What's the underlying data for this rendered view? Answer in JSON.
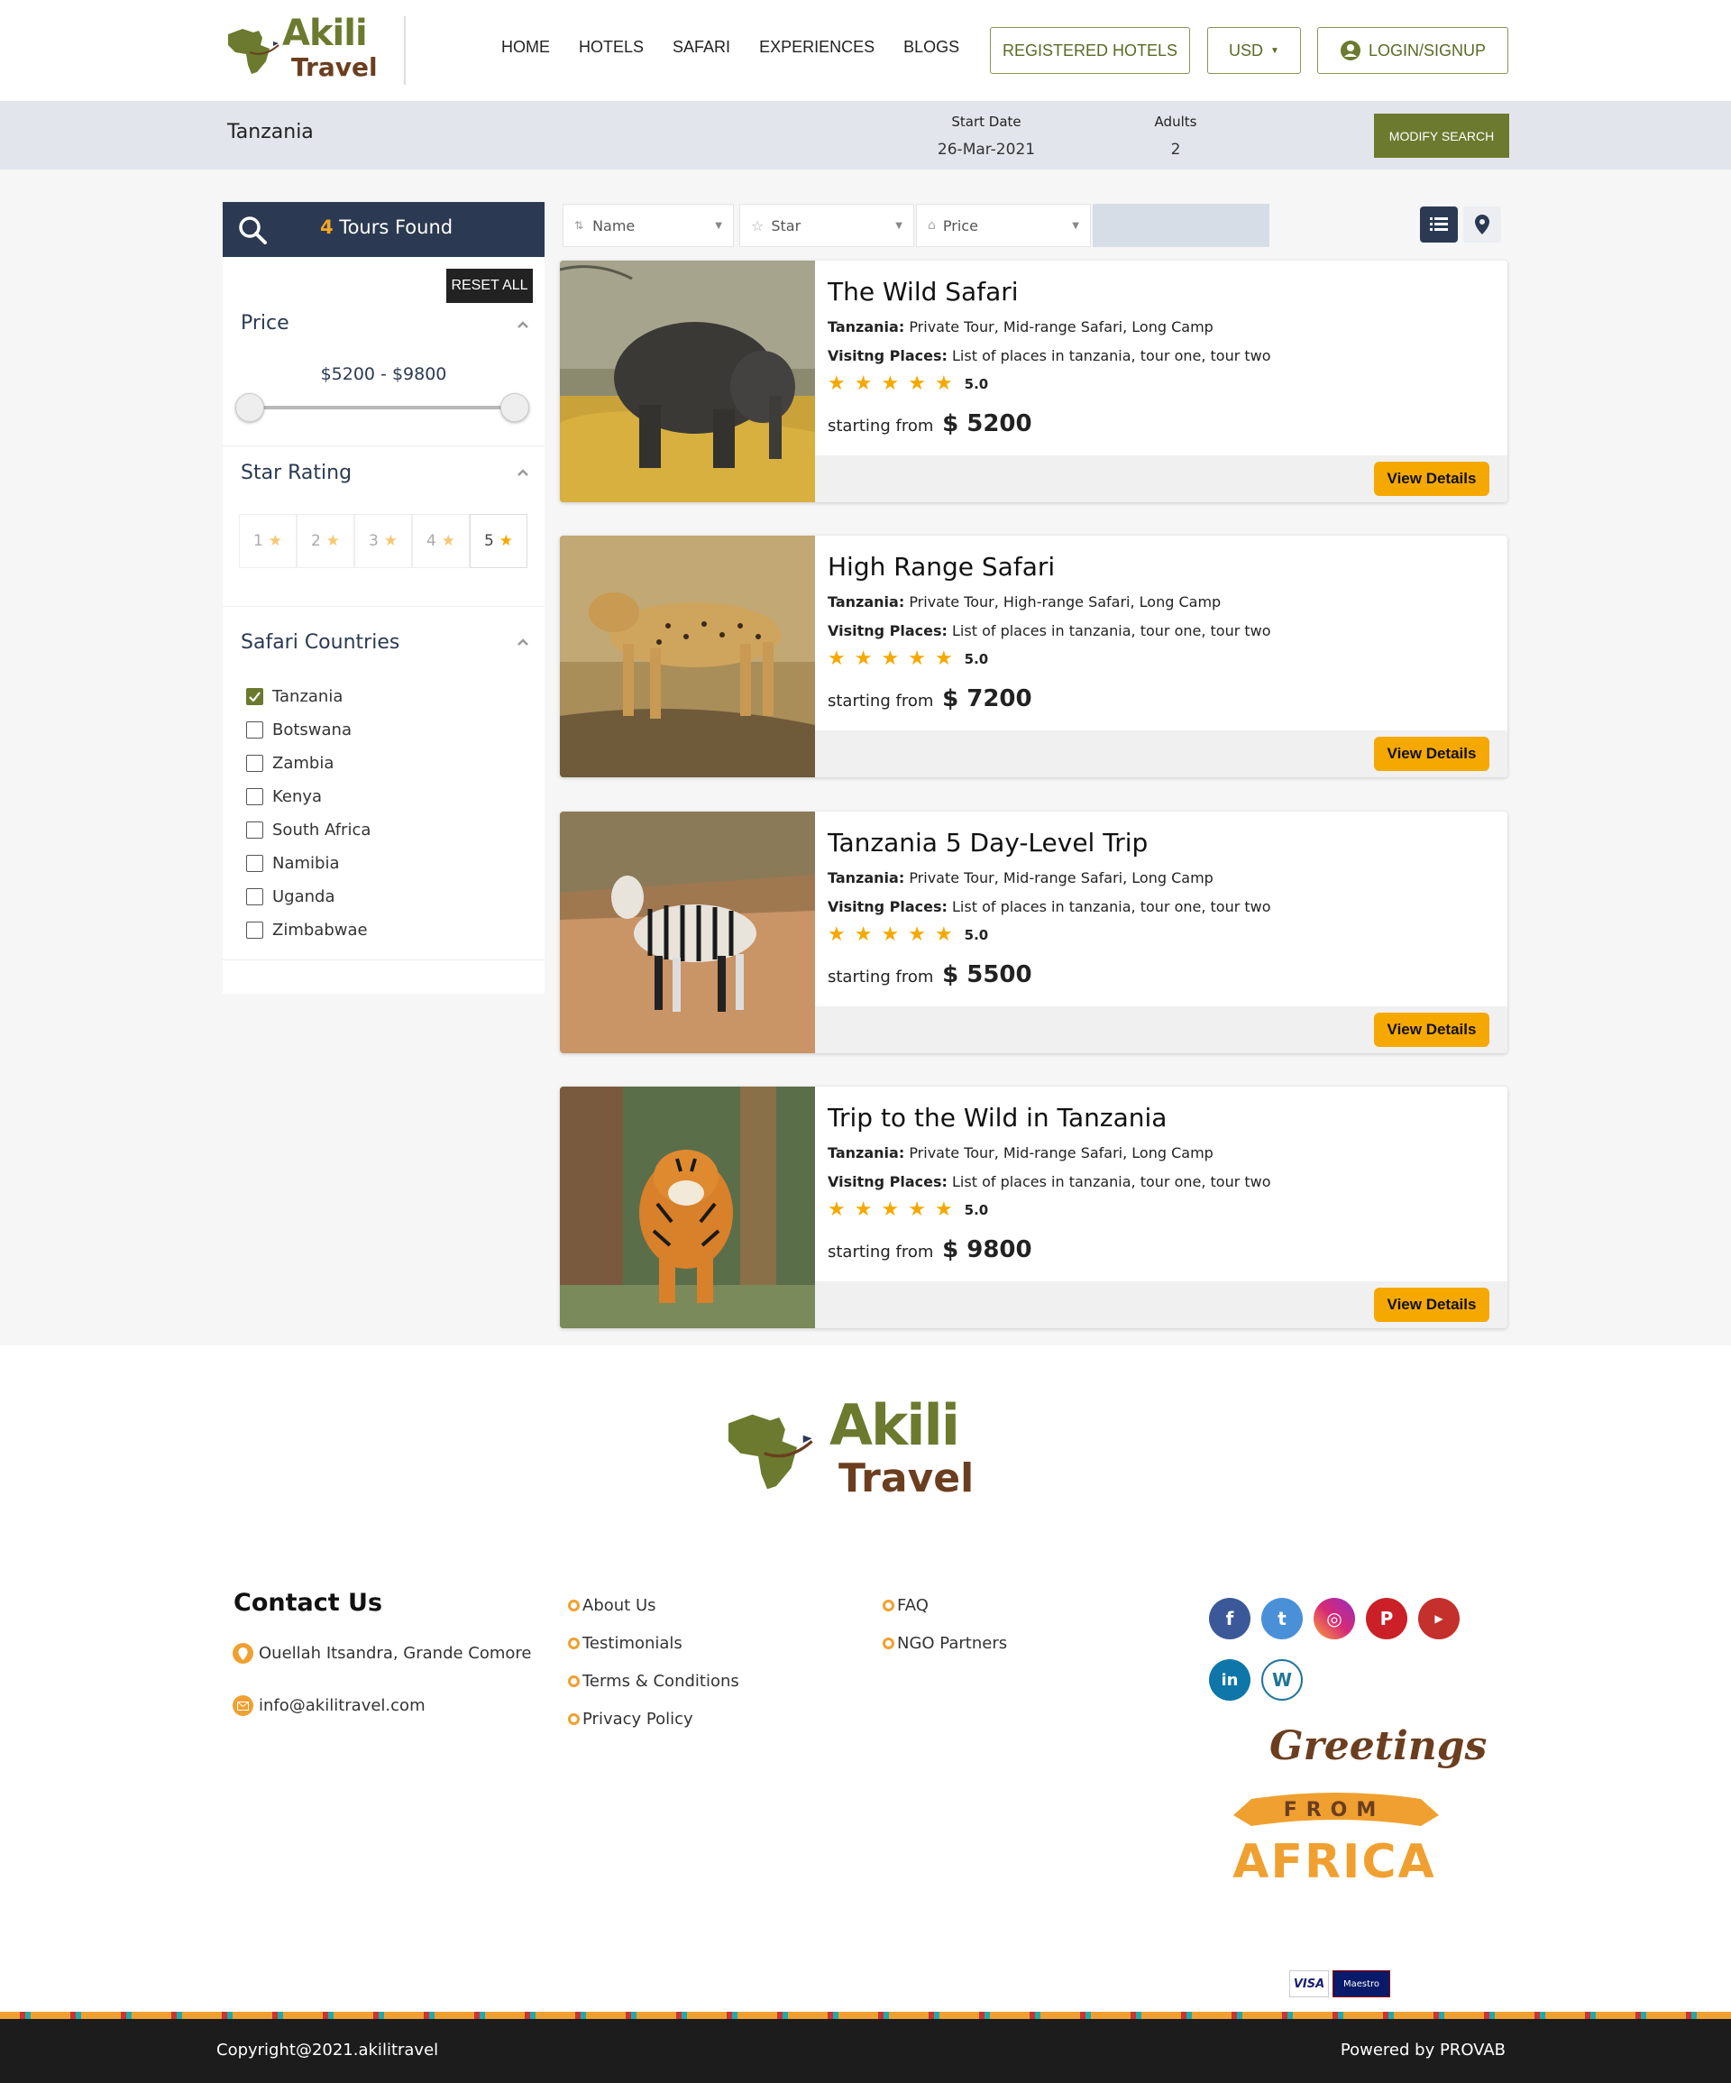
{
  "brand": {
    "name": "Akili",
    "sub": "Travel"
  },
  "nav": [
    "HOME",
    "HOTELS",
    "SAFARI",
    "EXPERIENCES",
    "BLOGS"
  ],
  "header_buttons": {
    "registered": "REGISTERED HOTELS",
    "currency": "USD",
    "login": "LOGIN/SIGNUP"
  },
  "search": {
    "destination": "Tanzania",
    "start_label": "Start Date",
    "start_value": "26-Mar-2021",
    "adults_label": "Adults",
    "adults_value": "2",
    "modify": "MODIFY SEARCH"
  },
  "sidebar": {
    "count": "4",
    "found_text": "Tours Found",
    "reset": "RESET ALL",
    "price_title": "Price",
    "price_range": "$5200 - $9800",
    "star_title": "Star Rating",
    "stars": [
      "1",
      "2",
      "3",
      "4",
      "5"
    ],
    "selected_star": "5",
    "countries_title": "Safari Countries",
    "countries": [
      {
        "name": "Tanzania",
        "checked": true
      },
      {
        "name": "Botswana",
        "checked": false
      },
      {
        "name": "Zambia",
        "checked": false
      },
      {
        "name": "Kenya",
        "checked": false
      },
      {
        "name": "South Africa",
        "checked": false
      },
      {
        "name": "Namibia",
        "checked": false
      },
      {
        "name": "Uganda",
        "checked": false
      },
      {
        "name": "Zimbabwae",
        "checked": false
      }
    ]
  },
  "sort": {
    "name": "Name",
    "star": "Star",
    "price": "Price"
  },
  "tours": [
    {
      "title": "The Wild Safari",
      "region": "Tanzania:",
      "type": "Private Tour, Mid-range Safari, Long Camp",
      "places_label": "Visitng Places:",
      "places": "List of places in tanzania, tour one, tour two",
      "score": "5.0",
      "from": "starting from",
      "price": "$ 5200",
      "button": "View Details"
    },
    {
      "title": "High Range Safari",
      "region": "Tanzania:",
      "type": "Private Tour, High-range Safari, Long Camp",
      "places_label": "Visitng Places:",
      "places": "List of places in tanzania, tour one, tour two",
      "score": "5.0",
      "from": "starting from",
      "price": "$ 7200",
      "button": "View Details"
    },
    {
      "title": "Tanzania 5 Day-Level Trip",
      "region": "Tanzania:",
      "type": "Private Tour, Mid-range Safari, Long Camp",
      "places_label": "Visitng Places:",
      "places": "List of places in tanzania, tour one, tour two",
      "score": "5.0",
      "from": "starting from",
      "price": "$ 5500",
      "button": "View Details"
    },
    {
      "title": "Trip to the Wild in Tanzania",
      "region": "Tanzania:",
      "type": "Private Tour, Mid-range Safari, Long Camp",
      "places_label": "Visitng Places:",
      "places": "List of places in tanzania, tour one, tour two",
      "score": "5.0",
      "from": "starting from",
      "price": "$ 9800",
      "button": "View Details"
    }
  ],
  "footer": {
    "contact_title": "Contact Us",
    "address": "Ouellah Itsandra, Grande Comore",
    "email": "info@akilitravel.com",
    "links_col1": [
      "About Us",
      "Testimonials",
      "Terms & Conditions",
      "Privacy Policy"
    ],
    "links_col2": [
      "FAQ",
      "NGO Partners"
    ],
    "social": [
      "facebook-icon",
      "twitter-icon",
      "instagram-icon",
      "pinterest-icon",
      "youtube-icon",
      "linkedin-icon",
      "wordpress-icon"
    ],
    "greeting": {
      "line1": "Greetings",
      "line2": "FROM",
      "line3": "AFRICA"
    },
    "payments": [
      "VISA",
      "Maestro"
    ],
    "copyright": "Copyright@2021.akilitravel",
    "powered": "Powered by PROVAB"
  },
  "colors": {
    "brand_green": "#6b7a2e",
    "brand_brown": "#6b3e1f",
    "accent_orange": "#f5a800",
    "navy": "#2b3a52"
  }
}
